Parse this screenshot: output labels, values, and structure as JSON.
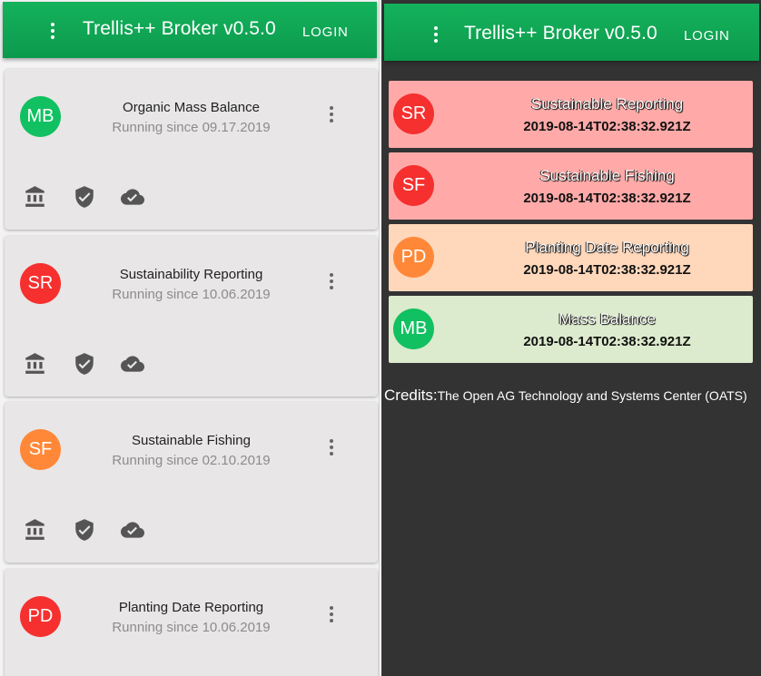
{
  "app": {
    "title": "Trellis++ Broker v0.5.0",
    "login_label": "LOGIN",
    "header_color": "#0fa755"
  },
  "left": {
    "cards": [
      {
        "initials": "MB",
        "avatar_color": "#11c061",
        "title": "Organic Mass Balance",
        "subtitle": "Running since 09.17.2019",
        "actions": [
          "bank-icon",
          "shield-check-icon",
          "cloud-check-icon"
        ]
      },
      {
        "initials": "SR",
        "avatar_color": "#f5302f",
        "title": "Sustainability Reporting",
        "subtitle": "Running since 10.06.2019",
        "actions": [
          "bank-icon",
          "shield-check-icon",
          "cloud-check-icon"
        ]
      },
      {
        "initials": "SF",
        "avatar_color": "#ff8838",
        "title": "Sustainable Fishing",
        "subtitle": "Running since 02.10.2019",
        "actions": [
          "bank-icon",
          "shield-check-icon",
          "cloud-check-icon"
        ]
      },
      {
        "initials": "PD",
        "avatar_color": "#f5302f",
        "title": "Planting Date Reporting",
        "subtitle": "Running since 10.06.2019"
      }
    ]
  },
  "right": {
    "statuses": [
      {
        "initials": "SR",
        "avatar_color": "#f5302f",
        "bg_color": "#ffaaa8",
        "title": "Sustainable Reporting",
        "timestamp": "2019-08-14T02:38:32.921Z"
      },
      {
        "initials": "SF",
        "avatar_color": "#f5302f",
        "bg_color": "#ffaaa8",
        "title": "Sustainable Fishing",
        "timestamp": "2019-08-14T02:38:32.921Z"
      },
      {
        "initials": "PD",
        "avatar_color": "#ff8838",
        "bg_color": "#ffd7bb",
        "title": "Planting Date Reporting",
        "timestamp": "2019-08-14T02:38:32.921Z"
      },
      {
        "initials": "MB",
        "avatar_color": "#11c061",
        "bg_color": "#dcebcd",
        "title": "Mass Balance",
        "timestamp": "2019-08-14T02:38:32.921Z"
      }
    ],
    "credits_label": "Credits:",
    "credits_text": "The Open AG Technology and Systems Center (OATS)"
  }
}
